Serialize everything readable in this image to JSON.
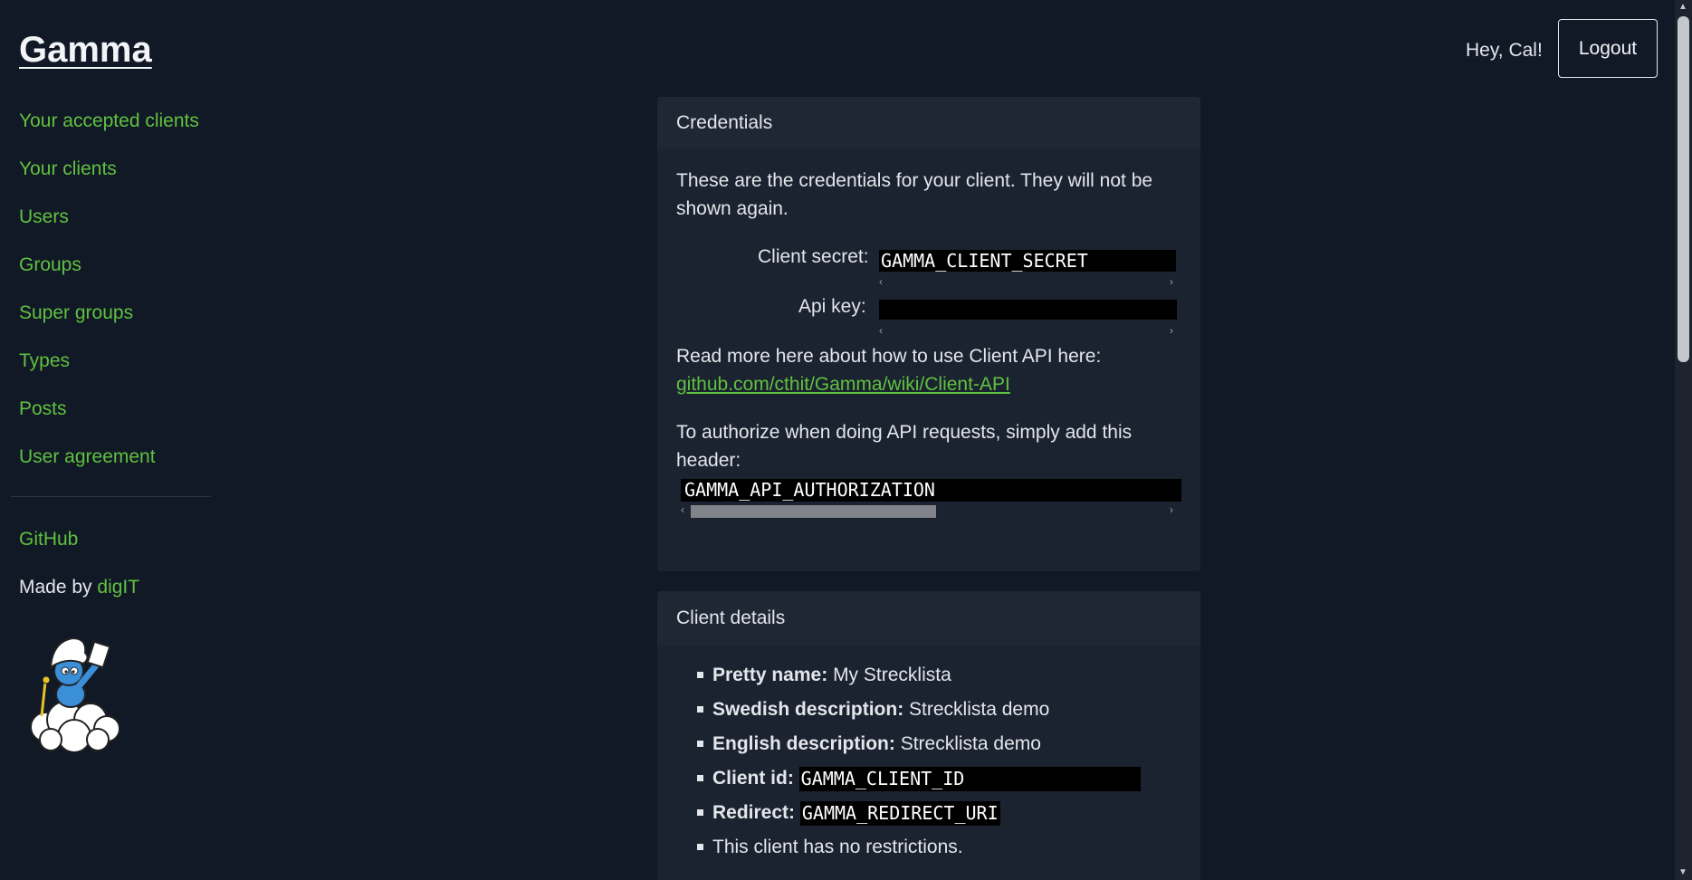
{
  "header": {
    "brand": "Gamma",
    "greeting": "Hey, Cal!",
    "logout_label": "Logout"
  },
  "sidebar": {
    "items": [
      {
        "label": "Your accepted clients"
      },
      {
        "label": "Your clients"
      },
      {
        "label": "Users"
      },
      {
        "label": "Groups"
      },
      {
        "label": "Super groups"
      },
      {
        "label": "Types"
      },
      {
        "label": "Posts"
      },
      {
        "label": "User agreement"
      }
    ],
    "github_label": "GitHub",
    "made_by_prefix": "Made by",
    "made_by_link": "digIT"
  },
  "credentials_card": {
    "title": "Credentials",
    "intro": "These are the credentials for your client. They will not be shown again.",
    "client_secret_label": "Client secret:",
    "client_secret_value": "GAMMA_CLIENT_SECRET",
    "api_key_label": "Api key:",
    "api_key_value": "",
    "read_more_text": "Read more here about how to use Client API here:",
    "read_more_link": "github.com/cthit/Gamma/wiki/Client-API",
    "authorize_text": "To authorize when doing API requests, simply add this header:",
    "authorization_value": "GAMMA_API_AUTHORIZATION"
  },
  "client_details_card": {
    "title": "Client details",
    "pretty_name_label": "Pretty name:",
    "pretty_name_value": "My Strecklista",
    "swedish_desc_label": "Swedish description:",
    "swedish_desc_value": "Strecklista demo",
    "english_desc_label": "English description:",
    "english_desc_value": "Strecklista demo",
    "client_id_label": "Client id:",
    "client_id_value": "GAMMA_CLIENT_ID",
    "redirect_label": "Redirect:",
    "redirect_value": "GAMMA_REDIRECT_URI",
    "restrictions_text": "This client has no restrictions."
  },
  "colors": {
    "background": "#121926",
    "card": "#1b2230",
    "accent_link": "#5fc13f"
  }
}
